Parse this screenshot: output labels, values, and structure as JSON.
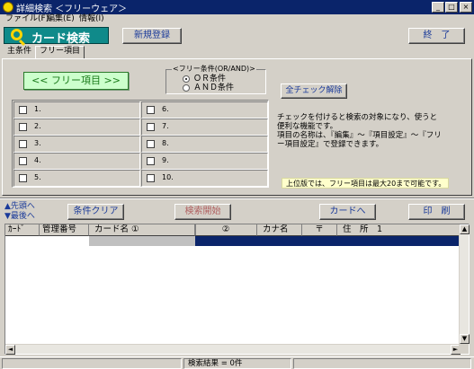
{
  "window": {
    "title": "詳細検索 ＜フリーウェア＞",
    "controls": {
      "minimize": "_",
      "maximize": "□",
      "close": "×"
    }
  },
  "menu": {
    "items": [
      "ファイル(F)",
      "編集(E)",
      "情報(I)"
    ]
  },
  "header": {
    "logo_text": "カード検索",
    "new_button": "新規登録",
    "exit_button": "終　了"
  },
  "tabs": [
    {
      "label": "主条件",
      "active": false
    },
    {
      "label": "フリー項目",
      "active": true
    }
  ],
  "free_panel": {
    "title_button": "<< フリー項目 >>",
    "condition_group": {
      "legend": "<フリー条件(OR/AND)>",
      "options": [
        {
          "label": "ＯＲ条件",
          "selected": true
        },
        {
          "label": "ＡＮＤ条件",
          "selected": false
        }
      ]
    },
    "clear_all_button": "全チェック解除",
    "items": [
      "1.",
      "2.",
      "3.",
      "4.",
      "5.",
      "6.",
      "7.",
      "8.",
      "9.",
      "10."
    ],
    "description": [
      "チェックを付けると検索の対象になり、使うと",
      "便利な機能です。",
      "項目の名称は、『編集』～『項目設定』～『フリ",
      "ー項目設定』で登録できます。"
    ],
    "note": "上位版では、フリー項目は最大20まで可能です。"
  },
  "toolbar": {
    "first_label": "▲先頭へ",
    "last_label": "▼最後へ",
    "clear_button": "条件クリア",
    "search_button": "検索開始",
    "card_button": "カードへ",
    "print_button": "印　刷"
  },
  "table": {
    "columns": [
      {
        "label": "ｶｰﾄﾞ",
        "style": "normal"
      },
      {
        "label": "管理番号",
        "style": "normal"
      },
      {
        "label": "カード名 ①",
        "style": "normal"
      },
      {
        "label": "",
        "style": "gray"
      },
      {
        "label": "②",
        "style": "normal"
      },
      {
        "label": "カナ名",
        "style": "normal"
      },
      {
        "label": "〒",
        "style": "normal"
      },
      {
        "label": "住　所　1",
        "style": "normal"
      },
      {
        "label": "",
        "style": "normal"
      }
    ],
    "scroll": {
      "up": "▲",
      "down": "▼",
      "left": "◄",
      "right": "►"
    }
  },
  "status": {
    "text": "検索結果 = 0件"
  }
}
